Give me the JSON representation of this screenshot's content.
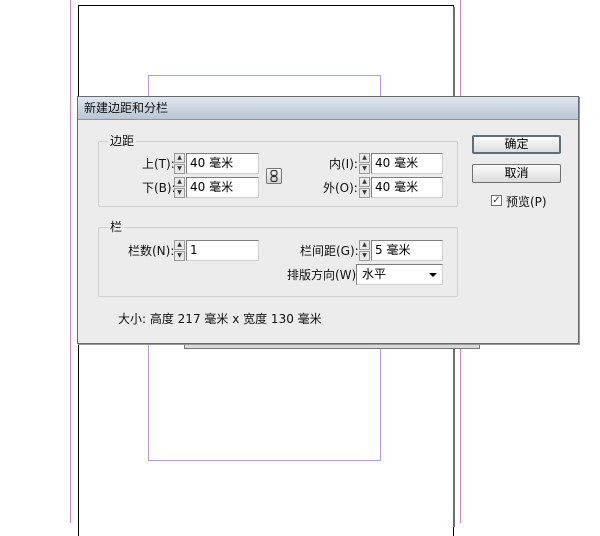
{
  "dialog": {
    "title": "新建边距和分栏",
    "ok_label": "确定",
    "cancel_label": "取消",
    "preview_label": "预览(P)",
    "preview_checked": true
  },
  "margins": {
    "group_title": "边距",
    "top_label": "上(T):",
    "top_value": "40 毫米",
    "bottom_label": "下(B):",
    "bottom_value": "40 毫米",
    "inside_label": "内(I):",
    "inside_value": "40 毫米",
    "outside_label": "外(O):",
    "outside_value": "40 毫米"
  },
  "columns": {
    "group_title": "栏",
    "number_label": "栏数(N):",
    "number_value": "1",
    "gutter_label": "栏间距(G):",
    "gutter_value": "5 毫米",
    "direction_label": "排版方向(W):",
    "direction_value": "水平"
  },
  "size_text": "大小: 高度 217 毫米 x 宽度 130 毫米"
}
